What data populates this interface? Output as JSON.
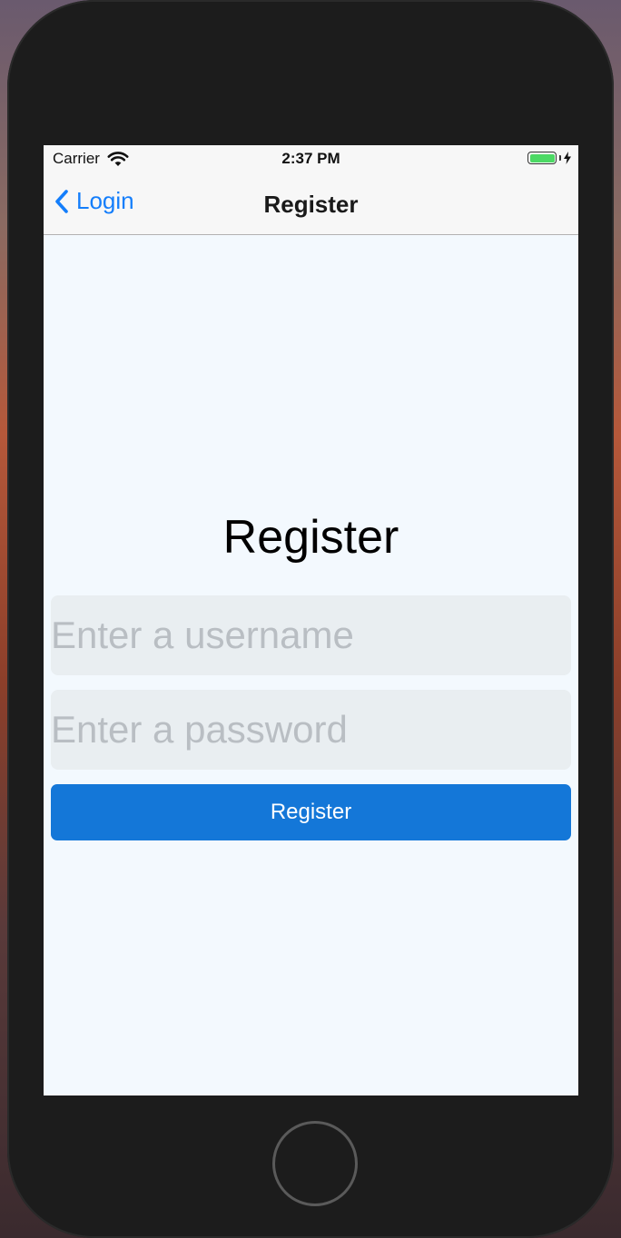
{
  "status_bar": {
    "carrier": "Carrier",
    "time": "2:37 PM",
    "battery_color": "#4cd964",
    "wifi_icon": "wifi-icon",
    "battery_icon": "battery-icon",
    "charging_icon": "lightning-bolt-icon"
  },
  "nav_bar": {
    "back_label": "Login",
    "back_icon": "chevron-left-icon",
    "title": "Register",
    "accent_color": "#147efb"
  },
  "form": {
    "heading": "Register",
    "username": {
      "value": "",
      "placeholder": "Enter a username"
    },
    "password": {
      "value": "",
      "placeholder": "Enter a password"
    },
    "submit_label": "Register",
    "submit_color": "#1477d8"
  },
  "device": {
    "home_button": "home-button"
  }
}
